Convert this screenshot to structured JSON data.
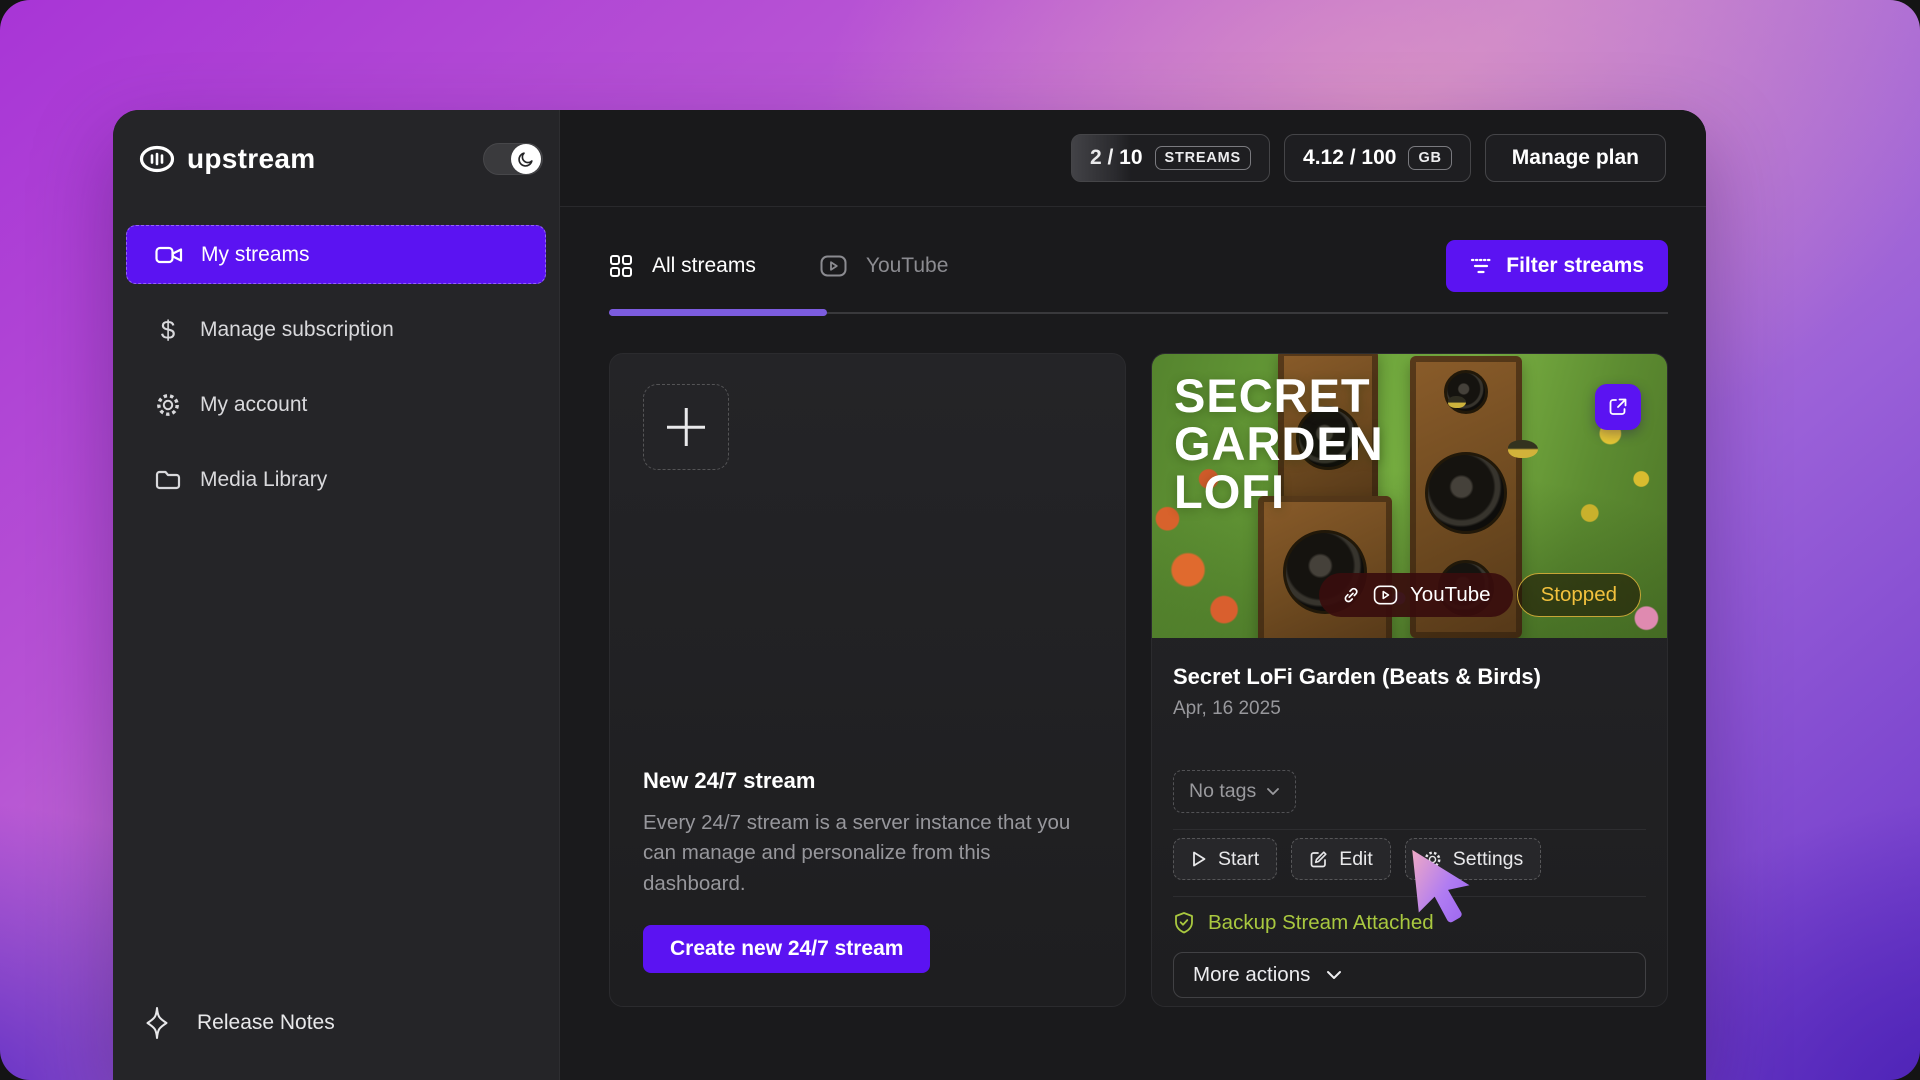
{
  "colors": {
    "accent": "#5b13f2",
    "tab_underline": "#7c5cdf",
    "backup_green": "#a9c83f",
    "status_yellow": "#f2c13d"
  },
  "icons": {
    "dollar_glyph": "$"
  },
  "brand": {
    "name": "upstream"
  },
  "sidebar": {
    "items": [
      {
        "label": "My streams"
      },
      {
        "label": "Manage subscription"
      },
      {
        "label": "My account"
      },
      {
        "label": "Media Library"
      }
    ],
    "footer_label": "Release Notes"
  },
  "header": {
    "streams": {
      "value": "2 / 10",
      "unit": "STREAMS"
    },
    "storage": {
      "value": "4.12 / 100",
      "unit": "GB"
    },
    "manage_plan": "Manage plan"
  },
  "toolbar": {
    "tabs": [
      {
        "label": "All streams"
      },
      {
        "label": "YouTube"
      }
    ],
    "filter_label": "Filter streams"
  },
  "new_stream_card": {
    "title": "New 24/7 stream",
    "description": "Every 24/7 stream is a server instance that you can manage and personalize from this dashboard.",
    "cta": "Create new 24/7 stream"
  },
  "stream_card": {
    "overlay_lines": [
      "SECRET",
      "GARDEN",
      "LOFI"
    ],
    "platform": "YouTube",
    "status": "Stopped",
    "title": "Secret LoFi Garden (Beats & Birds)",
    "date": "Apr, 16 2025",
    "tags": "No tags",
    "actions": {
      "start": "Start",
      "edit": "Edit",
      "settings": "Settings"
    },
    "backup": "Backup Stream Attached",
    "more": "More actions"
  }
}
